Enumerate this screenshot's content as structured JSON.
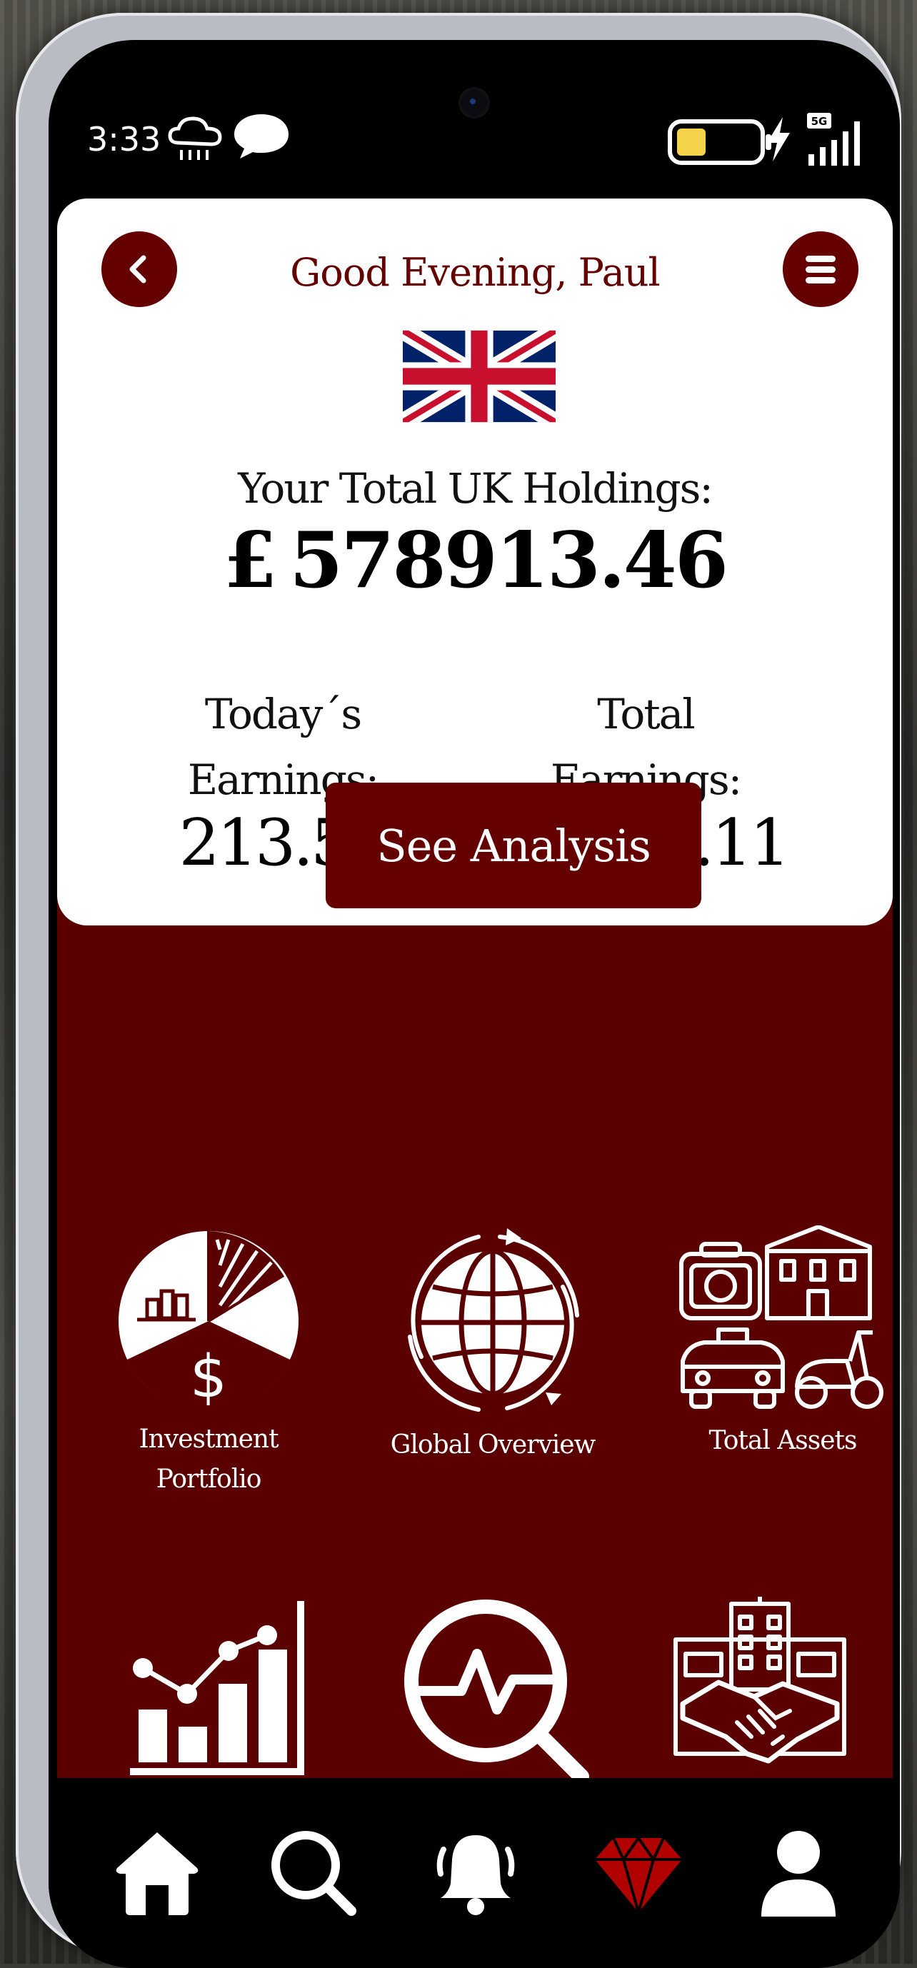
{
  "status": {
    "time": "3:33",
    "network": "5G"
  },
  "header": {
    "greeting": "Good Evening, Paul"
  },
  "holdings": {
    "label": "Your Total UK Holdings:",
    "currency_symbol": "£",
    "amount": "578913.46"
  },
  "stats": {
    "today": {
      "label_line1": "Today´s",
      "label_line2": "Earnings:",
      "value": "213.50"
    },
    "total": {
      "label_line1": "Total",
      "label_line2": "Earnings:",
      "value": "84732.11"
    }
  },
  "cta": {
    "see_analysis": "See Analysis"
  },
  "tiles": {
    "investment": {
      "label_line1": "Investment",
      "label_line2": "Portfolio"
    },
    "global": {
      "label": "Global Overview"
    },
    "assets": {
      "label": "Total Assets"
    }
  },
  "nav": {
    "items": [
      {
        "name": "home",
        "icon": "home-icon"
      },
      {
        "name": "search",
        "icon": "search-icon"
      },
      {
        "name": "alerts",
        "icon": "bell-icon"
      },
      {
        "name": "premium",
        "icon": "diamond-icon",
        "active": true
      },
      {
        "name": "profile",
        "icon": "user-icon"
      }
    ]
  },
  "colors": {
    "brand": "#650000",
    "section": "#5a0000",
    "active_nav": "#b00000",
    "battery": "#f4d24a"
  }
}
